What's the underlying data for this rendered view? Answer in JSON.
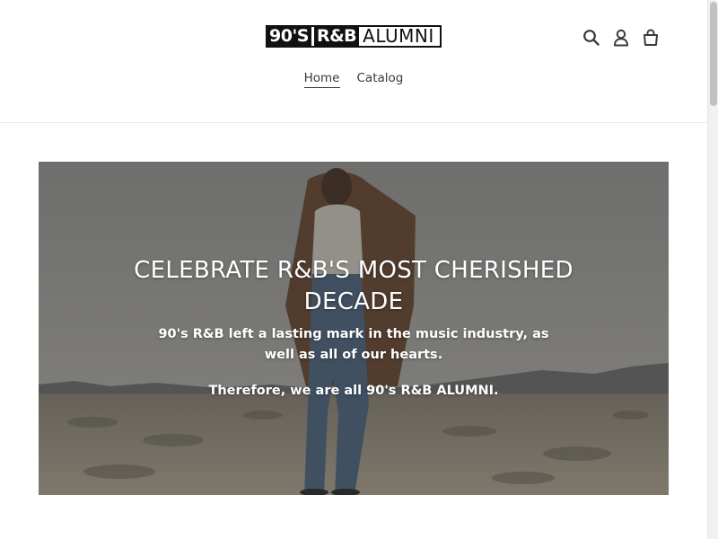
{
  "header": {
    "logo": {
      "part_a": "90'S",
      "part_b": "R&B",
      "part_c": "ALUMNI"
    },
    "icons": [
      "search-icon",
      "account-icon",
      "cart-icon"
    ]
  },
  "nav": {
    "items": [
      {
        "label": "Home",
        "active": true
      },
      {
        "label": "Catalog",
        "active": false
      }
    ]
  },
  "hero": {
    "title": "CELEBRATE R&B'S MOST CHERISHED DECADE",
    "subtitle": "90's R&B left a lasting mark in the music industry, as well as all of our hearts.",
    "tagline": "Therefore, we are all 90's R&B ALUMNI."
  },
  "colors": {
    "text": "#3a3a3a",
    "logo_black": "#111111",
    "hero_overlay": "#282828",
    "white": "#ffffff"
  }
}
